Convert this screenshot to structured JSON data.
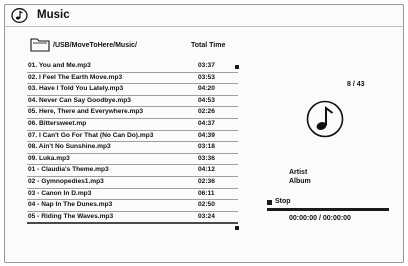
{
  "header": {
    "title": "Music",
    "icon": "music-note-circle-icon"
  },
  "folder": {
    "path": "/USB/MoveToHere/Music/",
    "icon": "folder-icon",
    "total_time_label": "Total Time"
  },
  "tracks": [
    {
      "name": "01. You and Me.mp3",
      "time": "03:37"
    },
    {
      "name": "02. I Feel The Earth Move.mp3",
      "time": "03:53"
    },
    {
      "name": "03. Have I Told You Lately.mp3",
      "time": "04:20"
    },
    {
      "name": "04. Never Can Say Goodbye.mp3",
      "time": "04:53"
    },
    {
      "name": "05. Here, There and Everywhere.mp3",
      "time": "02:26"
    },
    {
      "name": "06. Bittersweet.mp",
      "time": "04:37"
    },
    {
      "name": "07. I Can't Go For That (No Can Do).mp3",
      "time": "04:39"
    },
    {
      "name": "08. Ain't No Sunshine.mp3",
      "time": "03:18"
    },
    {
      "name": "09. Luka.mp3",
      "time": "03:36"
    },
    {
      "name": "01 - Claudia's Theme.mp3",
      "time": "04:12"
    },
    {
      "name": "02 - Gymnopedies1.mp3",
      "time": "02:36"
    },
    {
      "name": "03 - Canon In D.mp3",
      "time": "06:11"
    },
    {
      "name": "04 - Nap In The Dunes.mp3",
      "time": "02:50"
    },
    {
      "name": "05 - Riding The Waves.mp3",
      "time": "03:24"
    }
  ],
  "selected_index": 13,
  "now_playing": {
    "counter": "8 / 43",
    "art_icon": "music-note-icon",
    "artist_label": "Artist",
    "album_label": "Album",
    "status": "Stop",
    "time": "00:00:00 / 00:00:00",
    "progress": 0
  }
}
